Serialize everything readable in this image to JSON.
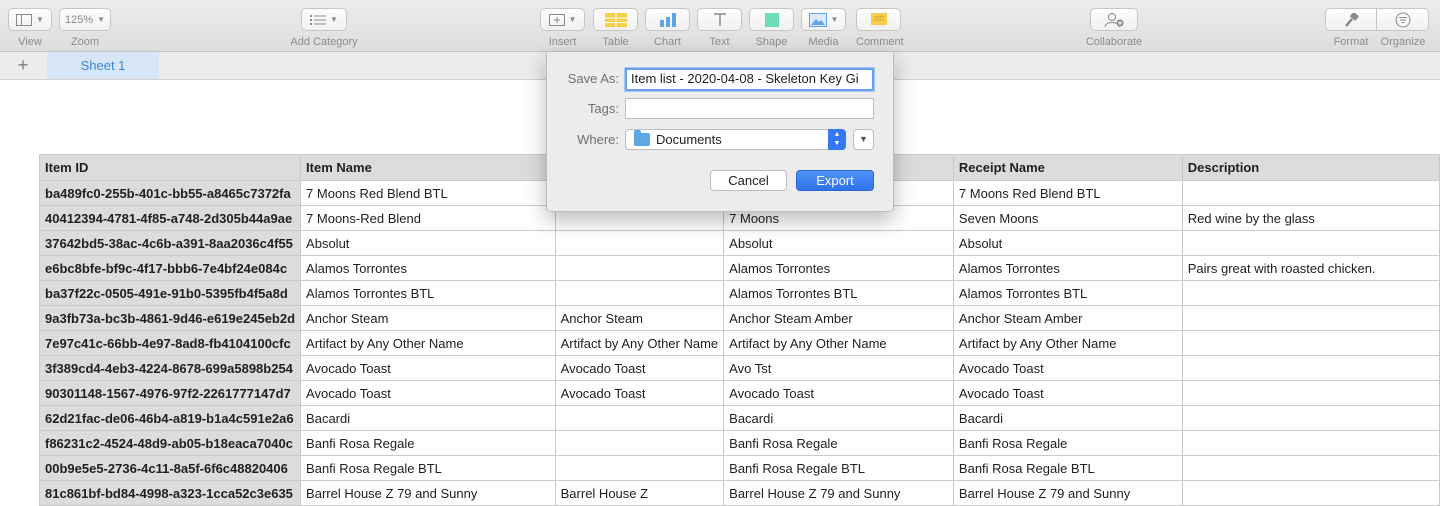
{
  "toolbar": {
    "view_label": "View",
    "zoom_value": "125%",
    "zoom_label": "Zoom",
    "add_category_label": "Add Category",
    "insert_label": "Insert",
    "table_label": "Table",
    "chart_label": "Chart",
    "text_label": "Text",
    "shape_label": "Shape",
    "media_label": "Media",
    "comment_label": "Comment",
    "collaborate_label": "Collaborate",
    "format_label": "Format",
    "organize_label": "Organize"
  },
  "sheets": {
    "add_symbol": "+",
    "tabs": [
      {
        "label": "Sheet 1",
        "active": true
      }
    ]
  },
  "dialog": {
    "save_as_label": "Save As:",
    "save_as_value": "Item list - 2020-04-08 - Skeleton Key Gi",
    "tags_label": "Tags:",
    "tags_value": "",
    "where_label": "Where:",
    "where_value": "Documents",
    "cancel_label": "Cancel",
    "export_label": "Export"
  },
  "table": {
    "columns": [
      "Item ID",
      "Item Name",
      "",
      "",
      "Receipt Name",
      "Description"
    ],
    "rows": [
      [
        "ba489fc0-255b-401c-bb55-a8465c7372fa",
        "7 Moons Red Blend BTL",
        "",
        "",
        "7 Moons Red Blend BTL",
        ""
      ],
      [
        "40412394-4781-4f85-a748-2d305b44a9ae",
        "7 Moons-Red Blend",
        "",
        "7 Moons",
        "Seven Moons",
        "Red wine by the glass"
      ],
      [
        "37642bd5-38ac-4c6b-a391-8aa2036c4f55",
        "Absolut",
        "",
        "Absolut",
        "Absolut",
        ""
      ],
      [
        "e6bc8bfe-bf9c-4f17-bbb6-7e4bf24e084c",
        "Alamos Torrontes",
        "",
        "Alamos Torrontes",
        "Alamos Torrontes",
        "Pairs great with roasted chicken."
      ],
      [
        "ba37f22c-0505-491e-91b0-5395fb4f5a8d",
        "Alamos Torrontes BTL",
        "",
        "Alamos Torrontes BTL",
        "Alamos Torrontes BTL",
        ""
      ],
      [
        "9a3fb73a-bc3b-4861-9d46-e619e245eb2d",
        "Anchor Steam",
        "Anchor Steam",
        "Anchor Steam Amber",
        "Anchor Steam Amber",
        ""
      ],
      [
        "7e97c41c-66bb-4e97-8ad8-fb4104100cfc",
        "Artifact by Any Other Name",
        "Artifact by Any Other Name",
        "Artifact by Any Other Name",
        "Artifact by Any Other Name",
        ""
      ],
      [
        "3f389cd4-4eb3-4224-8678-699a5898b254",
        "Avocado Toast",
        "Avocado Toast",
        "Avo Tst",
        "Avocado Toast",
        ""
      ],
      [
        "90301148-1567-4976-97f2-2261777147d7",
        "Avocado Toast",
        "Avocado Toast",
        "Avocado Toast",
        "Avocado Toast",
        ""
      ],
      [
        "62d21fac-de06-46b4-a819-b1a4c591e2a6",
        "Bacardi",
        "",
        "Bacardi",
        "Bacardi",
        ""
      ],
      [
        "f86231c2-4524-48d9-ab05-b18eaca7040c",
        "Banfi Rosa Regale",
        "",
        "Banfi Rosa Regale",
        "Banfi Rosa Regale",
        ""
      ],
      [
        "00b9e5e5-2736-4c11-8a5f-6f6c48820406",
        "Banfi Rosa Regale BTL",
        "",
        "Banfi Rosa Regale BTL",
        "Banfi Rosa Regale BTL",
        ""
      ],
      [
        "81c861bf-bd84-4998-a323-1cca52c3e635",
        "Barrel House Z 79 and Sunny",
        "Barrel House Z",
        "Barrel House Z 79 and Sunny",
        "Barrel House Z 79 and Sunny",
        ""
      ]
    ]
  }
}
